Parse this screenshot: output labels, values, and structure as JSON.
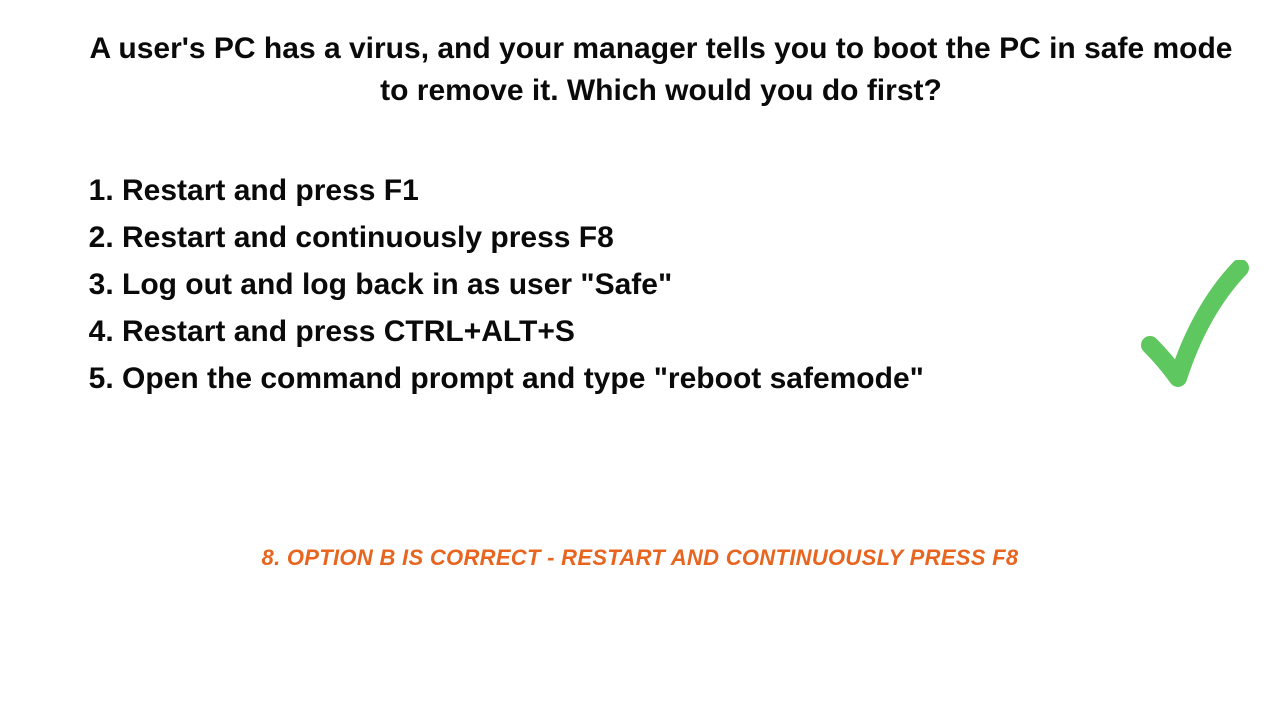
{
  "question": "A user's PC has a virus, and your manager tells you to boot the PC in safe mode to remove it. Which would you do first?",
  "options": [
    "Restart and press F1",
    "Restart and continuously press F8",
    "Log out and log back in as user \"Safe\"",
    "Restart and press CTRL+ALT+S",
    "Open the command prompt and type \"reboot safemode\""
  ],
  "answer": "8. Option B is correct - Restart and continuously press F8",
  "colors": {
    "text": "#0a0a0a",
    "answer": "#e8651f",
    "checkmark": "#5fc75f"
  },
  "correct_option_index": 1,
  "icons": {
    "checkmark": "checkmark-icon"
  }
}
